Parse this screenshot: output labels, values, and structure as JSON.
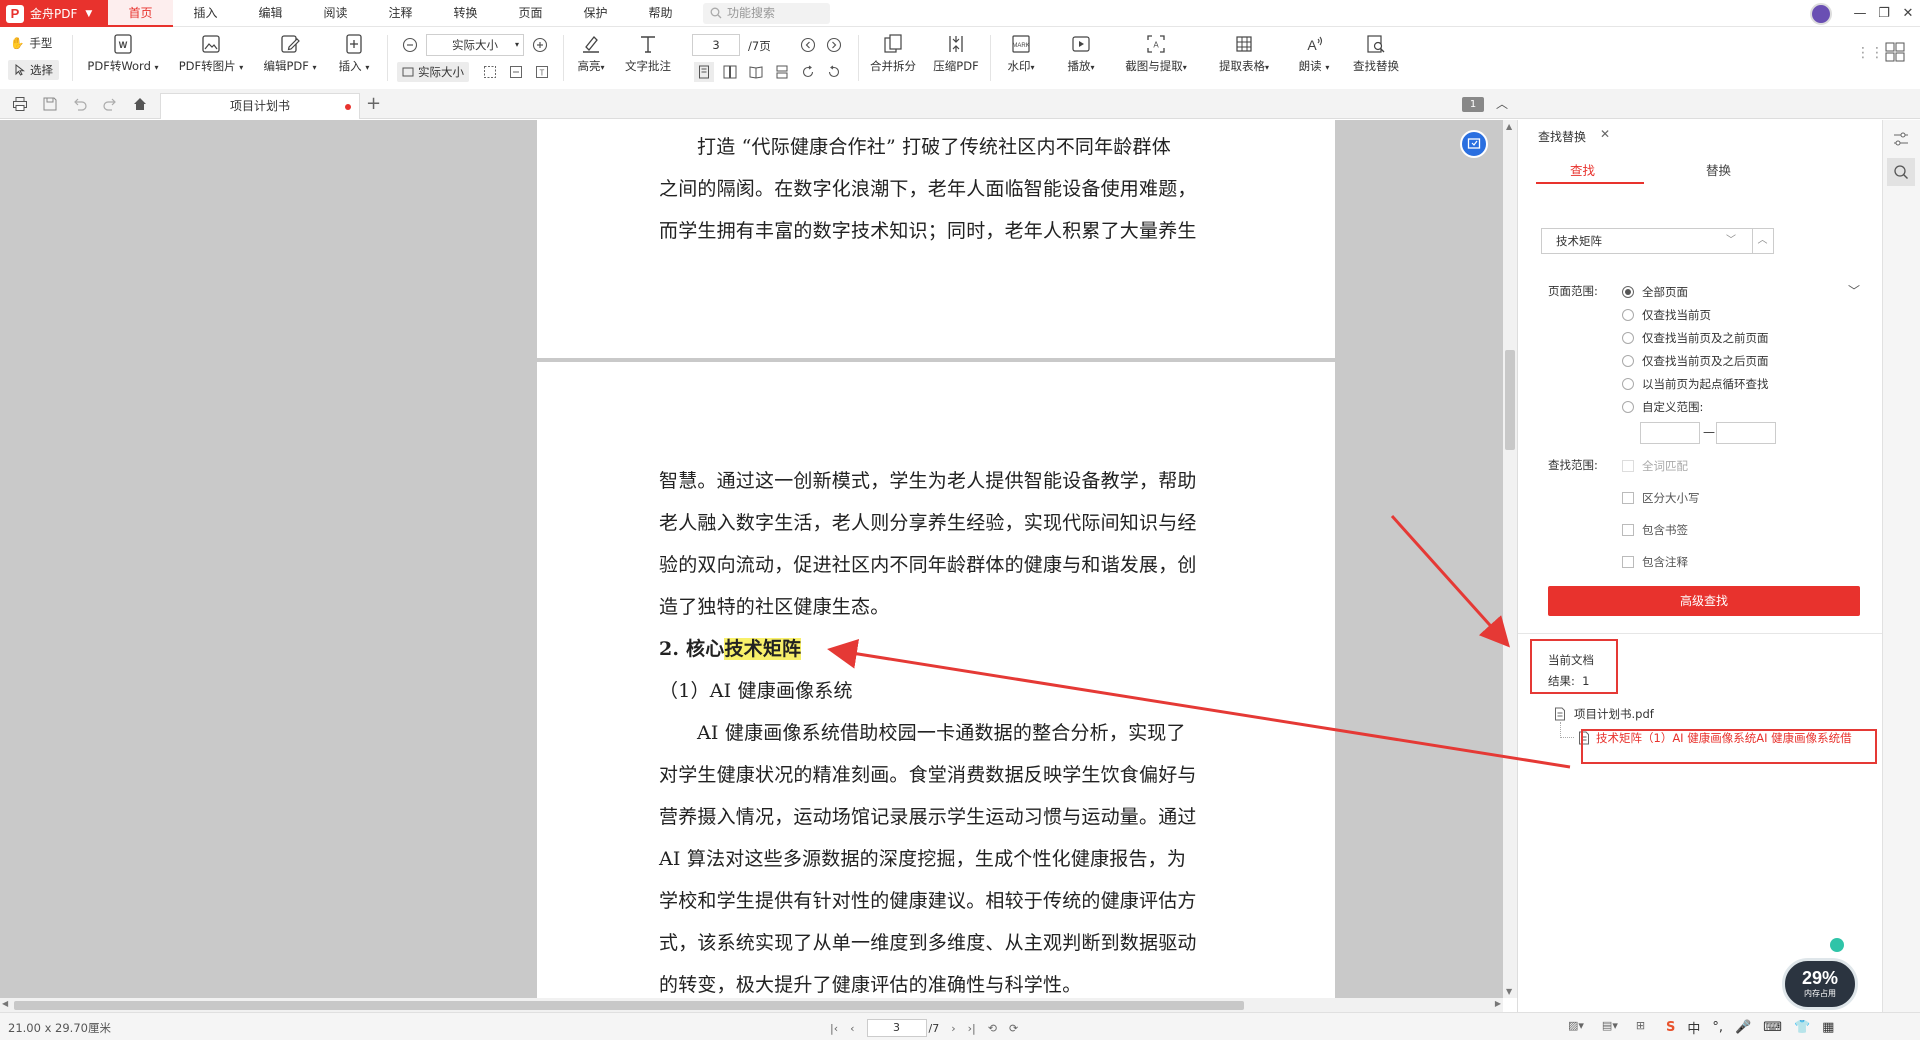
{
  "app": {
    "name": "金舟PDF"
  },
  "menu": {
    "tabs": [
      "首页",
      "插入",
      "编辑",
      "阅读",
      "注释",
      "转换",
      "页面",
      "保护",
      "帮助"
    ],
    "active": "首页",
    "search_placeholder": "功能搜索"
  },
  "ribbon": {
    "hand": "手型",
    "select": "选择",
    "pdf_to_word": "PDF转Word",
    "pdf_to_image": "PDF转图片",
    "edit_pdf": "编辑PDF",
    "insert": "插入",
    "zoom_value": "实际大小",
    "actual_size": "实际大小",
    "page_input": "3",
    "page_total": "/7页",
    "highlight": "高亮",
    "text_note": "文字批注",
    "merge_split": "合并拆分",
    "compress": "压缩PDF",
    "watermark": "水印",
    "play": "播放",
    "screenshot": "截图与提取",
    "extract_table": "提取表格",
    "read_aloud": "朗读",
    "find_replace": "查找替换"
  },
  "tabstrip": {
    "doc_tab": "项目计划书",
    "page_badge": "1"
  },
  "document": {
    "page1_lines": [
      "打造 “代际健康合作社” 打破了传统社区内不同年龄群体",
      "之间的隔阂。在数字化浪潮下，老年人面临智能设备使用难题，",
      "而学生拥有丰富的数字技术知识；同时，老年人积累了大量养生"
    ],
    "page2_lines": [
      "智慧。通过这一创新模式，学生为老人提供智能设备教学，帮助",
      "老人融入数字生活，老人则分享养生经验，实现代际间知识与经",
      "验的双向流动，促进社区内不同年龄群体的健康与和谐发展，创",
      "造了独特的社区健康生态。"
    ],
    "heading_prefix": "2. 核心",
    "heading_highlight": "技术矩阵",
    "subheading": "（1）AI 健康画像系统",
    "body_lines": [
      "AI 健康画像系统借助校园一卡通数据的整合分析，实现了",
      "对学生健康状况的精准刻画。食堂消费数据反映学生饮食偏好与",
      "营养摄入情况，运动场馆记录展示学生运动习惯与运动量。通过",
      "AI 算法对这些多源数据的深度挖掘，生成个性化健康报告，为",
      "学校和学生提供有针对性的健康建议。相较于传统的健康评估方",
      "式，该系统实现了从单一维度到多维度、从主观判断到数据驱动",
      "的转变，极大提升了健康评估的准确性与科学性。"
    ]
  },
  "panel": {
    "title": "查找替换",
    "tab_find": "查找",
    "tab_replace": "替换",
    "search_value": "技术矩阵",
    "page_range_label": "页面范围:",
    "page_range_options": [
      "全部页面",
      "仅查找当前页",
      "仅查找当前页及之前页面",
      "仅查找当前页及之后页面",
      "以当前页为起点循环查找",
      "自定义范围:"
    ],
    "range_dash": "—",
    "search_scope_label": "查找范围:",
    "scope_options": [
      "全词匹配",
      "区分大小写",
      "包含书签",
      "包含注释"
    ],
    "advanced_button": "高级查找",
    "current_doc_label": "当前文档",
    "result_label": "结果:  1",
    "file_name": "项目计划书.pdf",
    "result_item": "技术矩阵（1）AI 健康画像系统AI 健康画像系统借"
  },
  "statusbar": {
    "page_size": "21.00 x 29.70厘米",
    "page_input": "3",
    "page_total": "/7"
  },
  "widget": {
    "percent": "29%",
    "sub": "内存占用"
  },
  "ime": {
    "lang": "中"
  },
  "colors": {
    "brand": "#e8322d",
    "highlight": "#f8f06a",
    "annotation": "#e53935"
  }
}
